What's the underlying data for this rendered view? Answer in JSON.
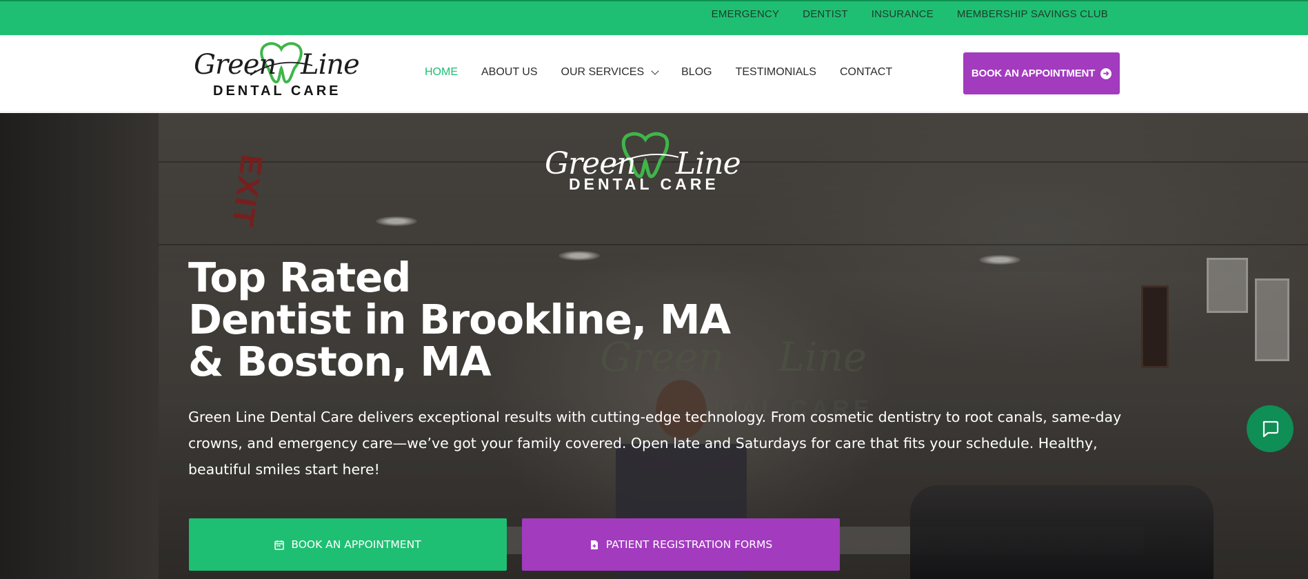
{
  "topbar": {
    "links": [
      "EMERGENCY",
      "DENTIST",
      "INSURANCE",
      "MEMBERSHIP SAVINGS CLUB"
    ]
  },
  "header": {
    "logo": {
      "script_left": "Green",
      "script_right": "Line",
      "subtitle": "DENTAL CARE"
    },
    "nav": {
      "home": "HOME",
      "about": "ABOUT US",
      "services": "OUR SERVICES",
      "blog": "BLOG",
      "testimonials": "TESTIMONIALS",
      "contact": "CONTACT"
    },
    "cta": "BOOK AN APPOINTMENT"
  },
  "hero": {
    "logo": {
      "script_left": "Green",
      "script_right": "Line",
      "subtitle": "DENTAL CARE"
    },
    "title_lines": [
      "Top Rated",
      "Dentist in Brookline, MA",
      "& Boston, MA"
    ],
    "description": "Green Line Dental Care delivers exceptional results with cutting-edge technology. From cosmetic dentistry to root canals, same-day crowns, and emergency care—we’ve got your family covered. Open late and Saturdays for care that fits your schedule. Healthy, beautiful smiles start here!",
    "buttons": {
      "book": "BOOK AN APPOINTMENT",
      "forms": "PATIENT REGISTRATION FORMS"
    },
    "background": {
      "exit_sign": "EXIT"
    }
  },
  "colors": {
    "brand_green": "#1fbf73",
    "brand_purple": "#a33bbf",
    "chat_green": "#0f8e55"
  },
  "icons": {
    "cta_arrow": "arrow-circle-right-icon",
    "book": "calendar-icon",
    "forms": "file-icon",
    "chat": "chat-icon",
    "services_dropdown": "chevron-down-icon"
  }
}
